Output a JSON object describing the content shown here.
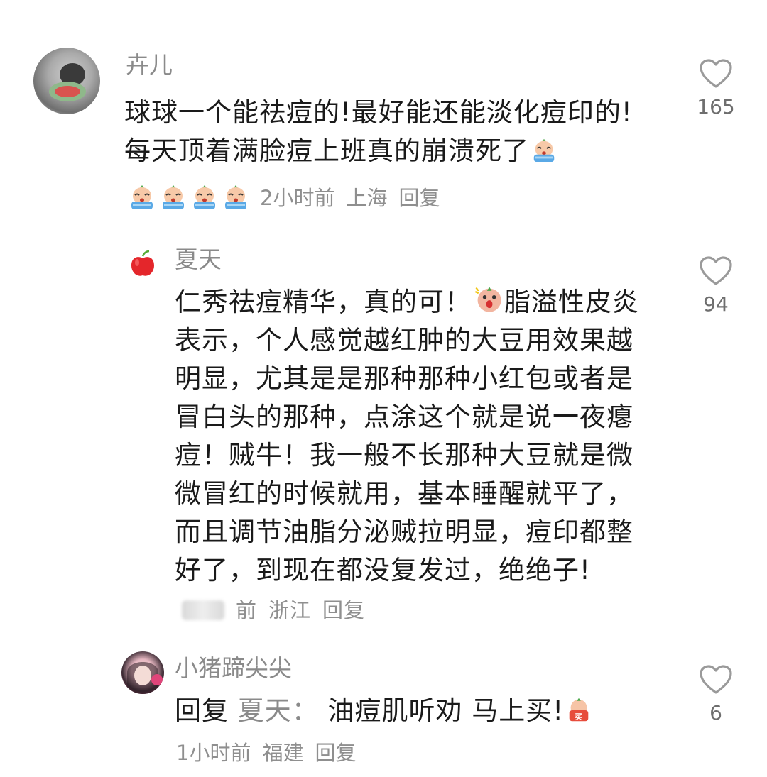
{
  "comments": [
    {
      "username": "卉儿",
      "text": "球球一个能祛痘的!最好能还能淡化痘印的!每天顶着满脸痘上班真的崩溃死了",
      "inline_emoji": "crying-emoji",
      "meta": {
        "time": "2小时前",
        "location": "上海",
        "reply": "回复"
      },
      "likes": "165",
      "leading_emojis": [
        "crying-emoji",
        "crying-emoji",
        "crying-emoji",
        "crying-emoji"
      ]
    },
    {
      "username": "夏天",
      "text_part1": "仁秀祛痘精华，真的可！",
      "text_emoji": "shocked-emoji",
      "text_part2": "脂溢性皮炎表示，个人感觉越红肿的大豆用效果越明显，尤其是是那种那种小红包或者是冒白头的那种，点涂这个就是说一夜瘪痘！贼牛！我一般不长那种大豆就是微微冒红的时候就用，基本睡醒就平了，而且调节油脂分泌贼拉明显，痘印都整好了，到现在都没复发过，绝绝子!",
      "meta": {
        "time": "前",
        "location": "浙江",
        "reply": "回复"
      },
      "likes": "94",
      "avatar": "apple-icon"
    },
    {
      "username": "小猪蹄尖尖",
      "reply_prefix": "回复",
      "reply_target": "夏天：",
      "text": "油痘肌听劝 马上买!",
      "inline_emoji": "buy-emoji",
      "meta": {
        "time": "1小时前",
        "location": "福建",
        "reply": "回复"
      },
      "likes": "6"
    }
  ],
  "colors": {
    "username": "#8a8a8a",
    "text": "#1a1a1a",
    "meta": "#8f8f8f",
    "heart": "#9a9a9a"
  }
}
